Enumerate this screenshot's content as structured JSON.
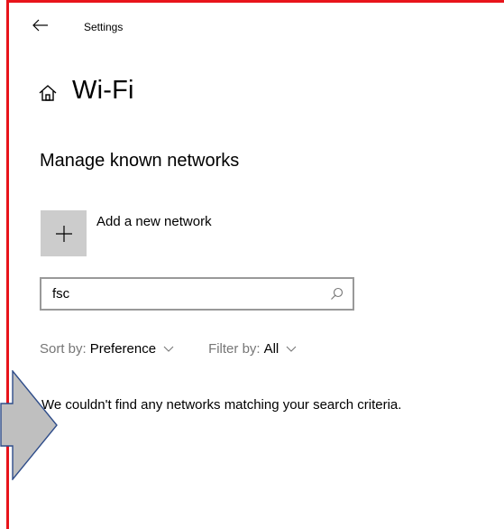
{
  "window": {
    "title": "Settings"
  },
  "page": {
    "title": "Wi-Fi"
  },
  "section": {
    "title": "Manage known networks"
  },
  "add_network": {
    "label": "Add a new network"
  },
  "search": {
    "value": "fsc"
  },
  "sort": {
    "label": "Sort by:",
    "value": "Preference"
  },
  "filter": {
    "label": "Filter by:",
    "value": "All"
  },
  "results": {
    "empty_message": "We couldn't find any networks matching your search criteria."
  },
  "colors": {
    "frame": "#e8141b",
    "tile": "#cccccc",
    "arrow_fill": "#bfbfbf",
    "arrow_stroke": "#2f4d8a",
    "muted_text": "#767676"
  },
  "icons": {
    "back": "back-arrow-icon",
    "home": "home-icon",
    "add": "plus-icon",
    "search": "search-icon",
    "dropdown": "chevron-down-icon",
    "callout": "arrow-callout-icon"
  }
}
